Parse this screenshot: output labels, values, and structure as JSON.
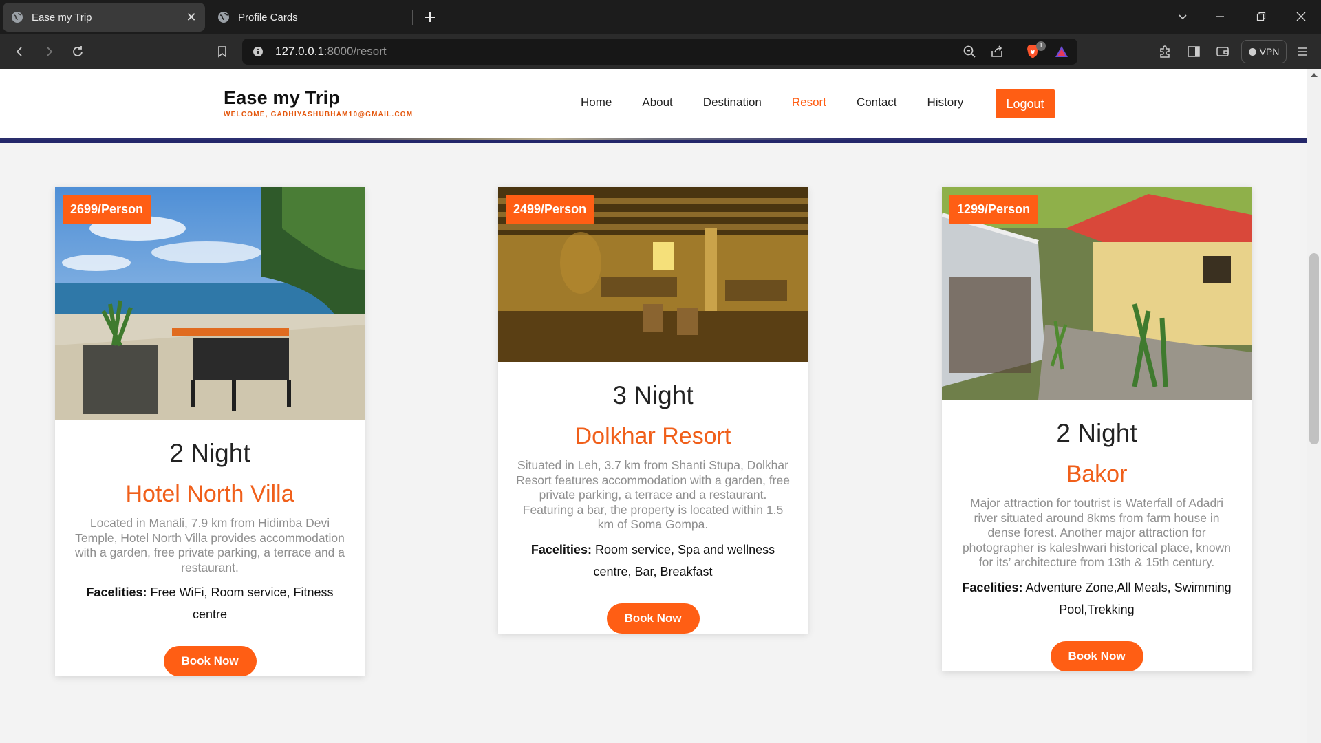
{
  "browser": {
    "tabs": [
      {
        "title": "Ease my Trip",
        "active": true
      },
      {
        "title": "Profile Cards",
        "active": false
      }
    ],
    "url_host": "127.0.0.1",
    "url_path": ":8000/resort",
    "vpn_label": "VPN",
    "brave_badge": "1"
  },
  "site": {
    "brand": "Ease my Trip",
    "welcome": "WELCOME, GADHIYASHUBHAM10@GMAIL.COM",
    "nav": [
      "Home",
      "About",
      "Destination",
      "Resort",
      "Contact",
      "History"
    ],
    "active_nav": "Resort",
    "logout_label": "Logout",
    "accent_color": "#ff5e14"
  },
  "cards": [
    {
      "price": "2699/Person",
      "nights": "2 Night",
      "name": "Hotel North Villa",
      "description": "Located in Manāli, 7.9 km from Hidimba Devi Temple, Hotel North Villa provides accommodation with a garden, free private parking, a terrace and a restaurant.",
      "facilities_label": "Facelities:",
      "facilities": "Free WiFi, Room service, Fitness centre",
      "button": "Book Now"
    },
    {
      "price": "2499/Person",
      "nights": "3 Night",
      "name": "Dolkhar Resort",
      "description": "Situated in Leh, 3.7 km from Shanti Stupa, Dolkhar Resort features accommodation with a garden, free private parking, a terrace and a restaurant. Featuring a bar, the property is located within 1.5 km of Soma Gompa.",
      "facilities_label": "Facelities:",
      "facilities": "Room service, Spa and wellness centre, Bar, Breakfast",
      "button": "Book Now"
    },
    {
      "price": "1299/Person",
      "nights": "2 Night",
      "name": "Bakor",
      "description": "Major attraction for toutrist is Waterfall of Adadri river situated around 8kms from farm house in dense forest. Another major attraction for photographer is kaleshwari historical place, known for its’ architecture from 13th & 15th century.",
      "facilities_label": "Facelities:",
      "facilities": "Adventure Zone,All Meals, Swimming Pool,Trekking",
      "button": "Book Now"
    }
  ]
}
